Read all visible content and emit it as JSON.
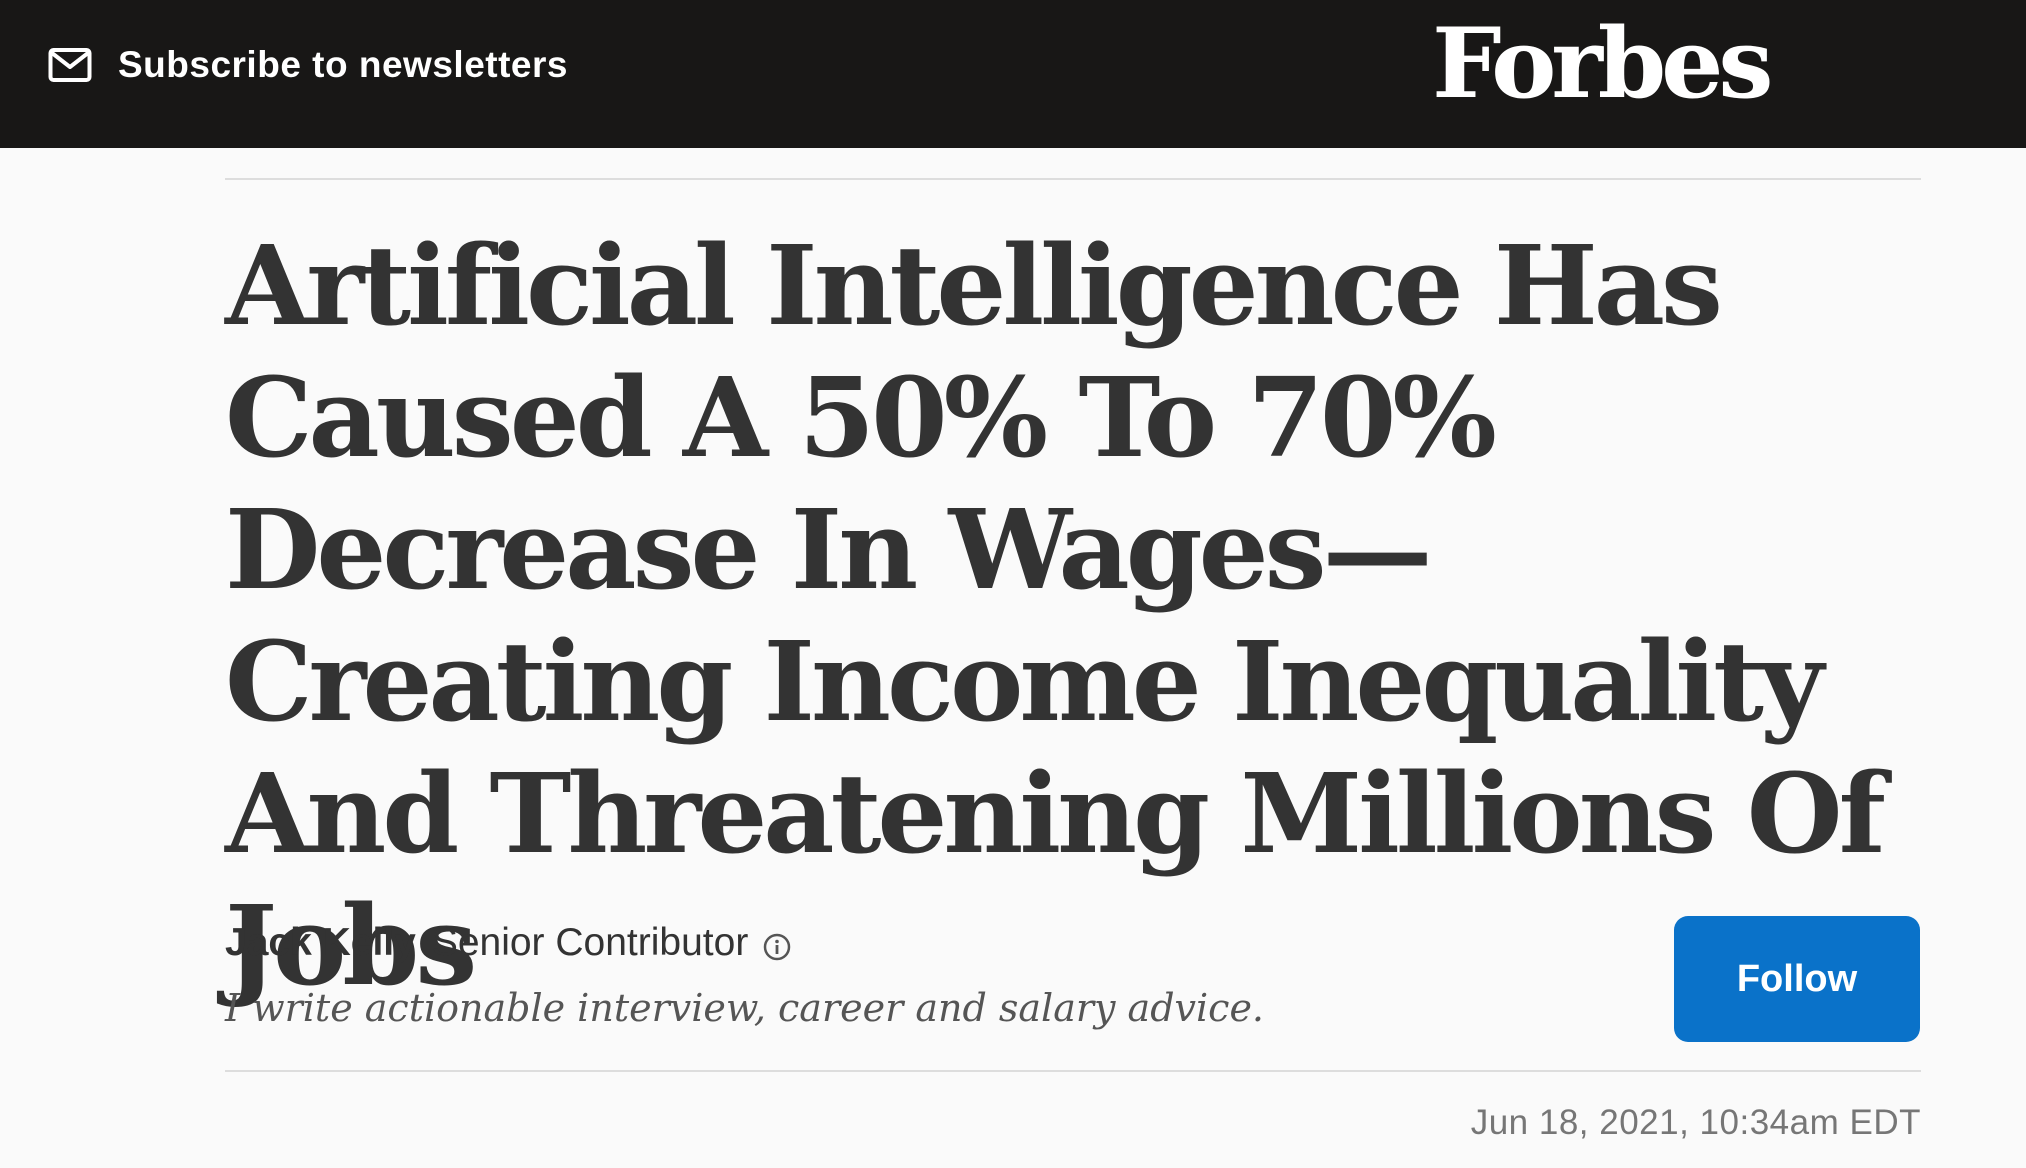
{
  "header": {
    "subscribe_label": "Subscribe to newsletters",
    "logo_text": "Forbes",
    "background": "#181716"
  },
  "article": {
    "headline": "Artificial Intelligence Has Caused A 50% To 70% Decrease In Wages—Creating Income Inequality And Threatening Millions Of Jobs",
    "author": {
      "name": "Jack Kelly",
      "role": "Senior Contributor",
      "bio": "I write actionable interview, career and salary advice."
    },
    "follow_label": "Follow",
    "date": "Jun 18, 2021, 10:34am EDT"
  },
  "colors": {
    "follow_button": "#0a72c9",
    "headline": "#333333"
  },
  "icons": [
    "mail-icon",
    "info-icon"
  ]
}
